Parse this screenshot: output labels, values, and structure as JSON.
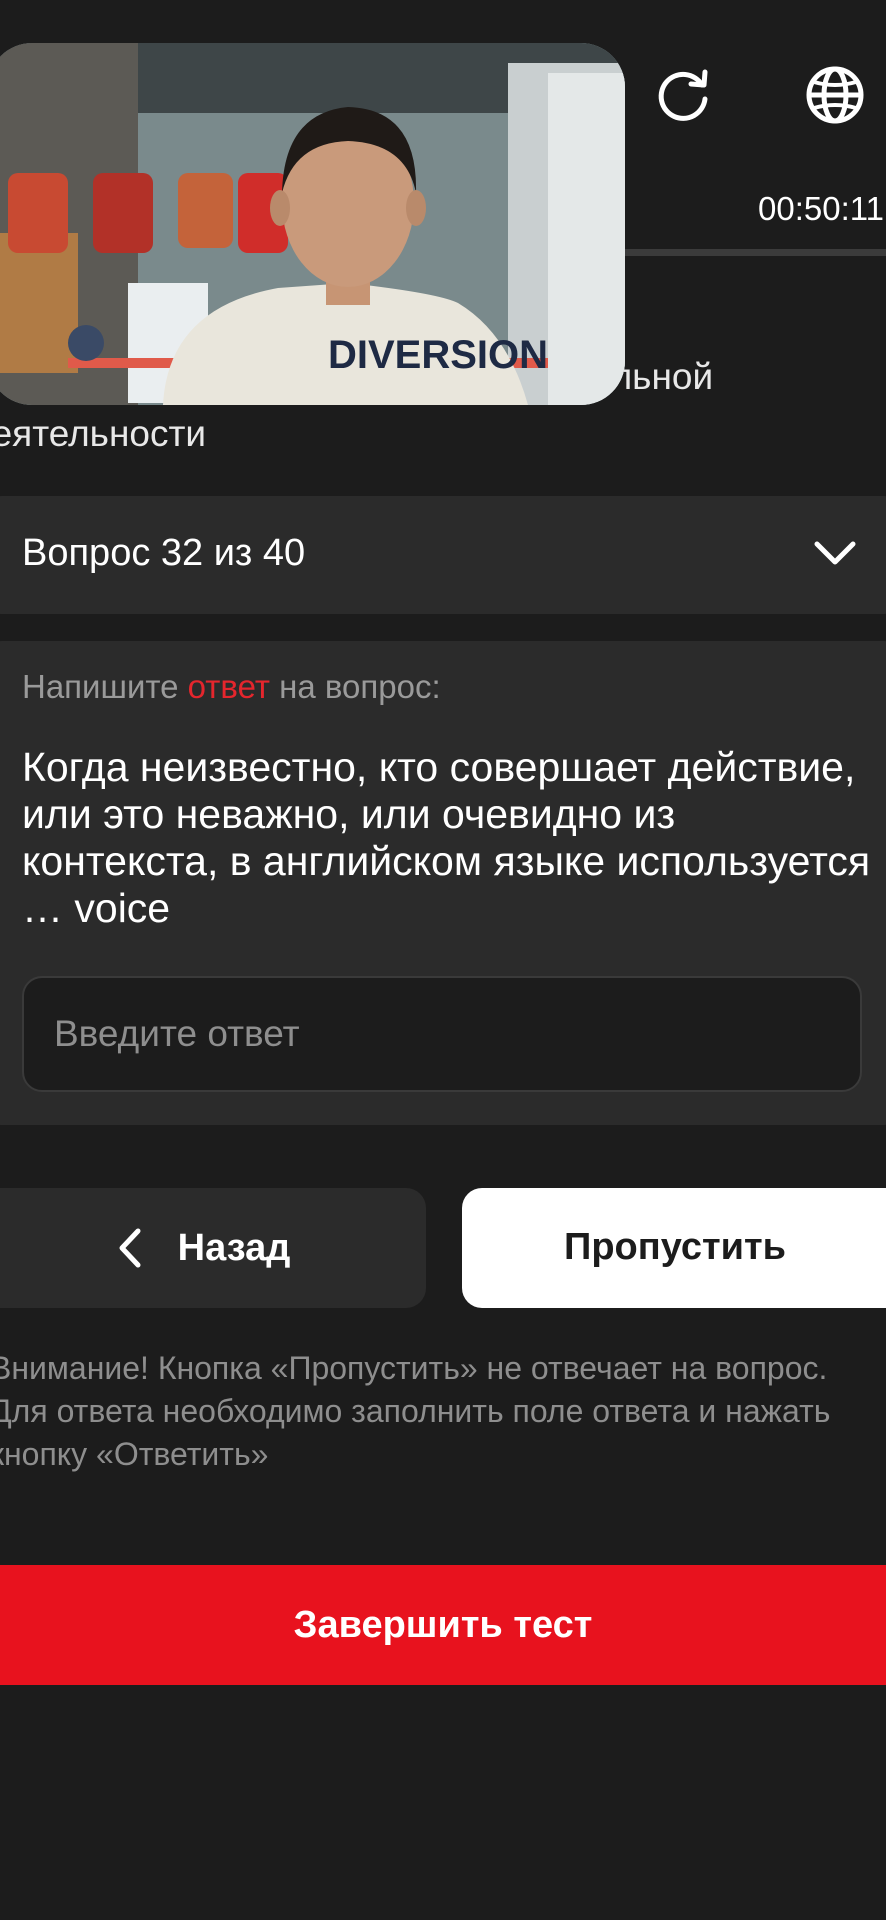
{
  "header": {
    "reload_icon": "reload-icon",
    "language_icon": "globe-icon",
    "timer": "00:50:11",
    "progress_fraction": 0.66,
    "accent_color": "#e5262d"
  },
  "context": {
    "title_fragment": "альной деятельности"
  },
  "video": {
    "shirt_text": "DIVERSION"
  },
  "question_selector": {
    "label": "Вопрос 32 из 40",
    "chevron_icon": "chevron-down-icon"
  },
  "question": {
    "prompt_before": "Напишите ",
    "prompt_accent": "ответ",
    "prompt_after": " на вопрос:",
    "text": "Когда неизвестно, кто совершает действие, или это неважно, или очевидно из контекста, в английском языке используется … voice"
  },
  "answer": {
    "placeholder": "Введите ответ",
    "value": ""
  },
  "actions": {
    "back_label": "Назад",
    "back_icon": "chevron-left-icon",
    "skip_label": "Пропустить",
    "notice": "Внимание! Кнопка «Пропустить» не отвечает на вопрос. Для ответа необходимо заполнить поле ответа и нажать кнопку «Ответить»",
    "finish_label": "Завершить тест",
    "finish_color": "#e8121e"
  }
}
